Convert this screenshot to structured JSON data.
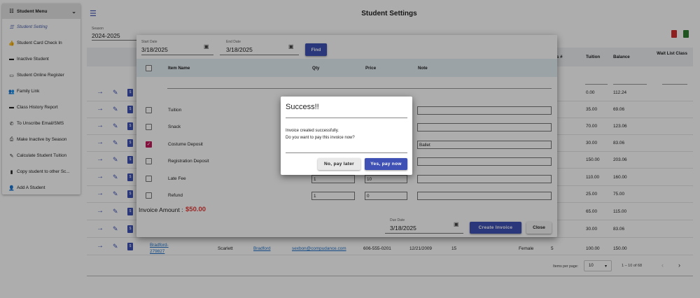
{
  "sidebar": {
    "title": "Student Menu",
    "items": [
      {
        "label": "Student Setting",
        "icon": "list-icon",
        "glyph": "☰",
        "active": true
      },
      {
        "label": "Student Card Check In",
        "icon": "thumbs-up-icon",
        "glyph": "👍"
      },
      {
        "label": "Inactive Student",
        "icon": "id-card-icon",
        "glyph": "▬"
      },
      {
        "label": "Student Online Register",
        "icon": "monitor-icon",
        "glyph": "▭"
      },
      {
        "label": "Family Link",
        "icon": "users-icon",
        "glyph": "👥"
      },
      {
        "label": "Class History Report",
        "icon": "id-card-icon",
        "glyph": "▬"
      },
      {
        "label": "To Unscribe Email/SMS",
        "icon": "phone-slash-icon",
        "glyph": "✆"
      },
      {
        "label": "Make Inactive by Season",
        "icon": "printer-icon",
        "glyph": "⎙"
      },
      {
        "label": "Calculate Student Tuition",
        "icon": "edit-icon",
        "glyph": "✎"
      },
      {
        "label": "Copy student to other Sc...",
        "icon": "file-icon",
        "glyph": "▮"
      },
      {
        "label": "Add A Student",
        "icon": "user-plus-icon",
        "glyph": "👤"
      }
    ]
  },
  "page": {
    "title": "Student Settings",
    "season_label": "Season",
    "season_value": "2024-2025"
  },
  "table": {
    "headers": {
      "class_num": "s #",
      "tuition": "Tuition",
      "balance": "Balance",
      "wait_list": "Wait List Class"
    },
    "rows": [
      {
        "tuition": "0.00",
        "balance": "112.24"
      },
      {
        "tuition": "35.00",
        "balance": "69.06"
      },
      {
        "tuition": "70.00",
        "balance": "123.06"
      },
      {
        "tuition": "30.00",
        "balance": "83.06"
      },
      {
        "tuition": "150.00",
        "balance": "203.06"
      },
      {
        "tuition": "110.00",
        "balance": "160.00"
      },
      {
        "tuition": "25.00",
        "balance": "75.00"
      },
      {
        "tuition": "65.00",
        "balance": "115.00"
      },
      {
        "tuition": "30.00",
        "balance": "83.06"
      }
    ],
    "last_row": {
      "id": "Bradford-",
      "id2": "279827",
      "first": "Scarlett",
      "last": "Bradford",
      "email": "sexbon@compudance.com",
      "phone": "606-555-0201",
      "dob": "12/21/2009",
      "age": "15",
      "gender": "Female",
      "class_num": "5",
      "tuition": "100.00",
      "balance": "150.00"
    }
  },
  "pagination": {
    "items_per_page_label": "Items per page:",
    "items_per_page": "10",
    "range": "1 – 10 of 68"
  },
  "invoice_dialog": {
    "start_date_label": "Start Date",
    "start_date": "3/18/2025",
    "end_date_label": "End Date",
    "end_date": "3/18/2025",
    "find_label": "Find",
    "headers": {
      "item_name": "Item Name",
      "qty": "Qty",
      "price": "Price",
      "note": "Note"
    },
    "items": [
      {
        "name": "Tuition",
        "checked": false,
        "qty": "",
        "price": "",
        "note": ""
      },
      {
        "name": "Snack",
        "checked": false,
        "qty": "",
        "price": "",
        "note": ""
      },
      {
        "name": "Costume Deposit",
        "checked": true,
        "qty": "",
        "price": "",
        "note": "Ballet"
      },
      {
        "name": "Registration Deposit",
        "checked": false,
        "qty": "",
        "price": "",
        "note": ""
      },
      {
        "name": "Late Fee",
        "checked": false,
        "qty": "1",
        "price": "10",
        "note": ""
      },
      {
        "name": "Refund",
        "checked": false,
        "qty": "1",
        "price": "0",
        "note": ""
      }
    ],
    "amount_label": "Invoice Amount :",
    "amount_value": "$50.00",
    "due_date_label": "Due Date",
    "due_date": "3/18/2025",
    "create_label": "Create Invoice",
    "close_label": "Close"
  },
  "success_dialog": {
    "title": "Success!!",
    "message_1": "Invoice created successfully.",
    "message_2": "Do you want to pay this invoice now?",
    "no_label": "No, pay later",
    "yes_label": "Yes, pay now"
  },
  "colors": {
    "primary": "#3f51b5",
    "danger": "#e53935",
    "checkbox_on": "#c2185b"
  }
}
